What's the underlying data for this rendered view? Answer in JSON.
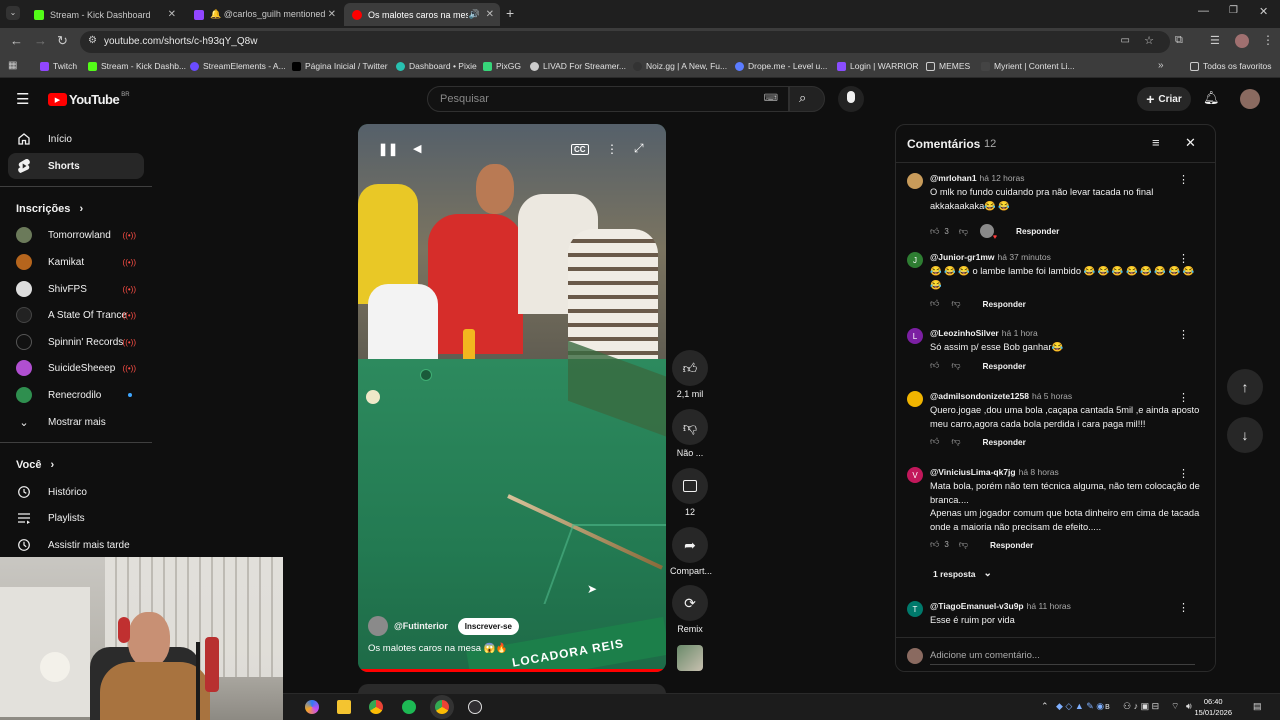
{
  "browser": {
    "tabs": [
      {
        "title": "Stream - Kick Dashboard",
        "color": "#53fc18"
      },
      {
        "title": "🔔 @carlos_guilh mentioned y...",
        "color": "#9146ff"
      },
      {
        "title": "Os malotes caros na mesa",
        "color": "#ff0000"
      }
    ],
    "url": "youtube.com/shorts/c-h93qY_Q8w",
    "bookmarks": [
      {
        "label": "Twitch",
        "color": "#9146ff"
      },
      {
        "label": "Stream - Kick Dashb...",
        "color": "#53fc18"
      },
      {
        "label": "StreamElements - A...",
        "color": "#6a4cff"
      },
      {
        "label": "Página Inicial / Twitter",
        "color": "#000000"
      },
      {
        "label": "Dashboard • Pixie",
        "color": "#28c1b0"
      },
      {
        "label": "PixGG",
        "color": "#37d67a"
      },
      {
        "label": "LIVAD For Streamer...",
        "color": "#cccccc"
      },
      {
        "label": "Noiz.gg | A New, Fu...",
        "color": "#333333"
      },
      {
        "label": "Drope.me - Level u...",
        "color": "#5b7cff"
      },
      {
        "label": "Login | WARRIOR",
        "color": "#8a4dff"
      },
      {
        "label": "MEMES",
        "color": "#e8c46a"
      },
      {
        "label": "Myrient | Content Li...",
        "color": "#444444"
      }
    ],
    "all_favorites": "Todos os favoritos"
  },
  "header": {
    "logo_text": "YouTube",
    "region": "BR",
    "search_placeholder": "Pesquisar",
    "create_label": "Criar"
  },
  "sidebar": {
    "home": "Início",
    "shorts": "Shorts",
    "subscriptions_heading": "Inscrições",
    "subscriptions": [
      {
        "name": "Tomorrowland",
        "color": "#6b7a5a",
        "live": true
      },
      {
        "name": "Kamikat",
        "color": "#b5651d",
        "live": true
      },
      {
        "name": "ShivFPS",
        "color": "#dddddd",
        "live": true
      },
      {
        "name": "A State Of Trance",
        "color": "#222222",
        "live": true
      },
      {
        "name": "Spinnin' Records",
        "color": "#111111",
        "live": true
      },
      {
        "name": "SuicideSheeep",
        "color": "#b04fd0",
        "live": true
      },
      {
        "name": "Renecrodilo",
        "color": "#2f8f4f",
        "live": false
      }
    ],
    "show_more": "Mostrar mais",
    "you_heading": "Você",
    "history": "Histórico",
    "playlists": "Playlists",
    "watch_later": "Assistir mais tarde"
  },
  "video": {
    "channel": "@Futinterior",
    "subscribe_label": "Inscrever-se",
    "title": "Os malotes caros na mesa 😱🔥",
    "banner_text": "LOCADORA REIS",
    "cc_label": "CC"
  },
  "actions": {
    "likes": "2,1 mil",
    "dislike_label": "Não ...",
    "comments_count": "12",
    "share_label": "Compart...",
    "remix_label": "Remix"
  },
  "comments_panel": {
    "title": "Comentários",
    "count": "12",
    "add_placeholder": "Adicione um comentário...",
    "reply_label": "Responder",
    "comments": [
      {
        "author": "@mrlohan1",
        "time": "há 12 horas",
        "text": "O mlk no fundo cuidando pra não levar tacada no final akkakaakaka😂 😂",
        "likes": "3",
        "avatar": "#c89b5a",
        "initial": "",
        "creator_heart": true
      },
      {
        "author": "@Junior-gr1mw",
        "time": "há 37 minutos",
        "text": "😂 😂 😂 o lambe lambe foi lambido 😂 😂 😂 😂 😂 😂 😂 😂 😂",
        "likes": "",
        "avatar": "#2e7d32",
        "initial": "J",
        "creator_heart": false
      },
      {
        "author": "@LeozinhoSilver",
        "time": "há 1 hora",
        "text": "Só assim p/ esse Bob ganhar😂",
        "likes": "",
        "avatar": "#7b1fa2",
        "initial": "L",
        "creator_heart": false
      },
      {
        "author": "@admilsondonizete1258",
        "time": "há 5 horas",
        "text": "Quero.jogae ,dou uma bola ,caçapa cantada 5mil ,e ainda aposto meu carro,agora cada bola perdida i cara paga mil!!!",
        "likes": "",
        "avatar": "#f0b400",
        "initial": "",
        "creator_heart": false
      },
      {
        "author": "@ViniciusLima-qk7jg",
        "time": "há 8 horas",
        "text": "Mata bola, porém não tem técnica alguma, não tem colocação de branca....",
        "text2": "Apenas um jogador comum que bota dinheiro em cima de tacada onde a maioria não precisam de efeito.....",
        "likes": "3",
        "avatar": "#c2185b",
        "initial": "V",
        "creator_heart": false,
        "replies_label": "1 resposta"
      },
      {
        "author": "@TiagoEmanuel-v3u9p",
        "time": "há 11 horas",
        "text": "Esse é ruim por vida",
        "likes": "",
        "avatar": "#00796b",
        "initial": "T",
        "creator_heart": false
      }
    ]
  },
  "taskbar": {
    "time": "06:40",
    "date": "15/01/2026"
  }
}
